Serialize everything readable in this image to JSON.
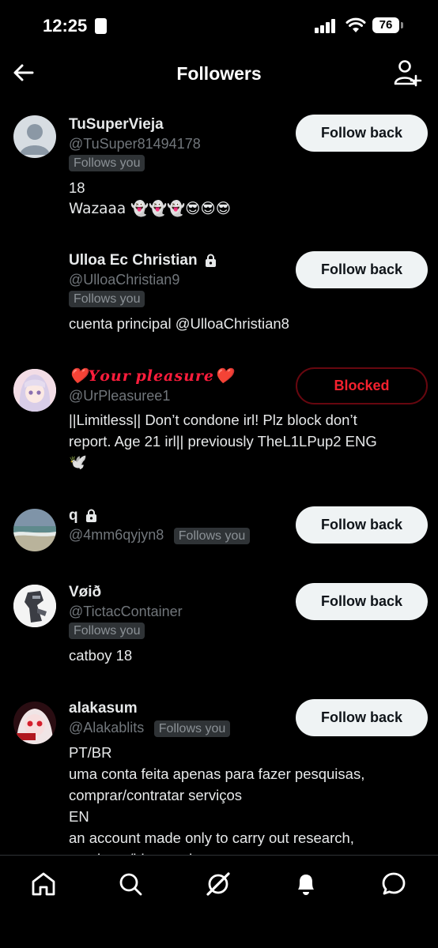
{
  "status": {
    "time": "12:25",
    "battery": "76"
  },
  "header": {
    "title": "Followers"
  },
  "followers": [
    {
      "name": "TuSuperVieja",
      "handle": "@TuSuper81494178",
      "follows_label": "Follows you",
      "bio_lines": [
        "18",
        "Wazaaa 👻👻👻😎😎😎"
      ],
      "button": "Follow back"
    },
    {
      "name": "Ulloa Ec Christian",
      "handle": "@UlloaChristian9",
      "follows_label": "Follows you",
      "bio_lines": [
        "cuenta principal @UlloaChristian8"
      ],
      "button": "Follow back"
    },
    {
      "name": "❤️𝒀𝒐𝒖𝒓 𝒑𝒍𝒆𝒂𝒔𝒖𝒓𝒆❤️",
      "handle": "@UrPleasuree1",
      "bio_lines": [
        "||Limitless|| Don’t condone irl! Plz block don’t",
        "report. Age 21 irl|| previously TheL1LPup2 ENG",
        "🕊️"
      ],
      "button": "Blocked"
    },
    {
      "name": "q",
      "handle": "@4mm6qyjyn8",
      "follows_label": "Follows you",
      "button": "Follow back"
    },
    {
      "name": "Vøið",
      "handle": "@TictacContainer",
      "follows_label": "Follows you",
      "bio_lines": [
        "catboy 18"
      ],
      "button": "Follow back"
    },
    {
      "name": "alakasum",
      "handle": "@Alakablits",
      "follows_label": "Follows you",
      "bio_lines": [
        "PT/BR",
        "uma conta feita apenas para fazer pesquisas,",
        "comprar/contratar serviços",
        "EN",
        "an account made only to carry out research,",
        "purchase/hire services"
      ],
      "button": "Follow back"
    }
  ],
  "nav": {
    "icons": [
      "home-icon",
      "search-icon",
      "grok-icon",
      "notifications-icon",
      "messages-icon"
    ]
  },
  "colors": {
    "background": "#000000",
    "button_bg": "#eff3f4",
    "muted": "#71767b",
    "blocked_red": "#f4212e"
  }
}
